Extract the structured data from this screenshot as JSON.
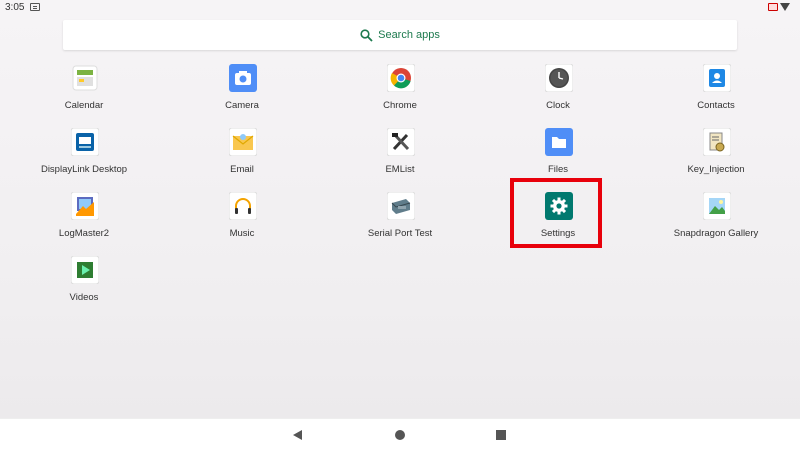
{
  "status_bar": {
    "time": "3:05"
  },
  "search": {
    "label": "Search apps"
  },
  "apps": [
    {
      "label": "Calendar",
      "icon": "calendar-icon"
    },
    {
      "label": "Camera",
      "icon": "camera-icon"
    },
    {
      "label": "Chrome",
      "icon": "chrome-icon"
    },
    {
      "label": "Clock",
      "icon": "clock-icon"
    },
    {
      "label": "Contacts",
      "icon": "contacts-icon"
    },
    {
      "label": "DisplayLink Desktop",
      "icon": "displaylink-icon"
    },
    {
      "label": "Email",
      "icon": "email-icon"
    },
    {
      "label": "EMList",
      "icon": "emlist-icon"
    },
    {
      "label": "Files",
      "icon": "files-icon"
    },
    {
      "label": "Key_Injection",
      "icon": "key-injection-icon"
    },
    {
      "label": "LogMaster2",
      "icon": "logmaster-icon"
    },
    {
      "label": "Music",
      "icon": "music-icon"
    },
    {
      "label": "Serial Port Test",
      "icon": "serial-port-icon"
    },
    {
      "label": "Settings",
      "icon": "settings-icon"
    },
    {
      "label": "Snapdragon Gallery",
      "icon": "gallery-icon"
    },
    {
      "label": "Videos",
      "icon": "videos-icon"
    }
  ],
  "colors": {
    "accent": "#1d7a4e",
    "highlight": "#e8000b",
    "settings": "#01796f"
  }
}
